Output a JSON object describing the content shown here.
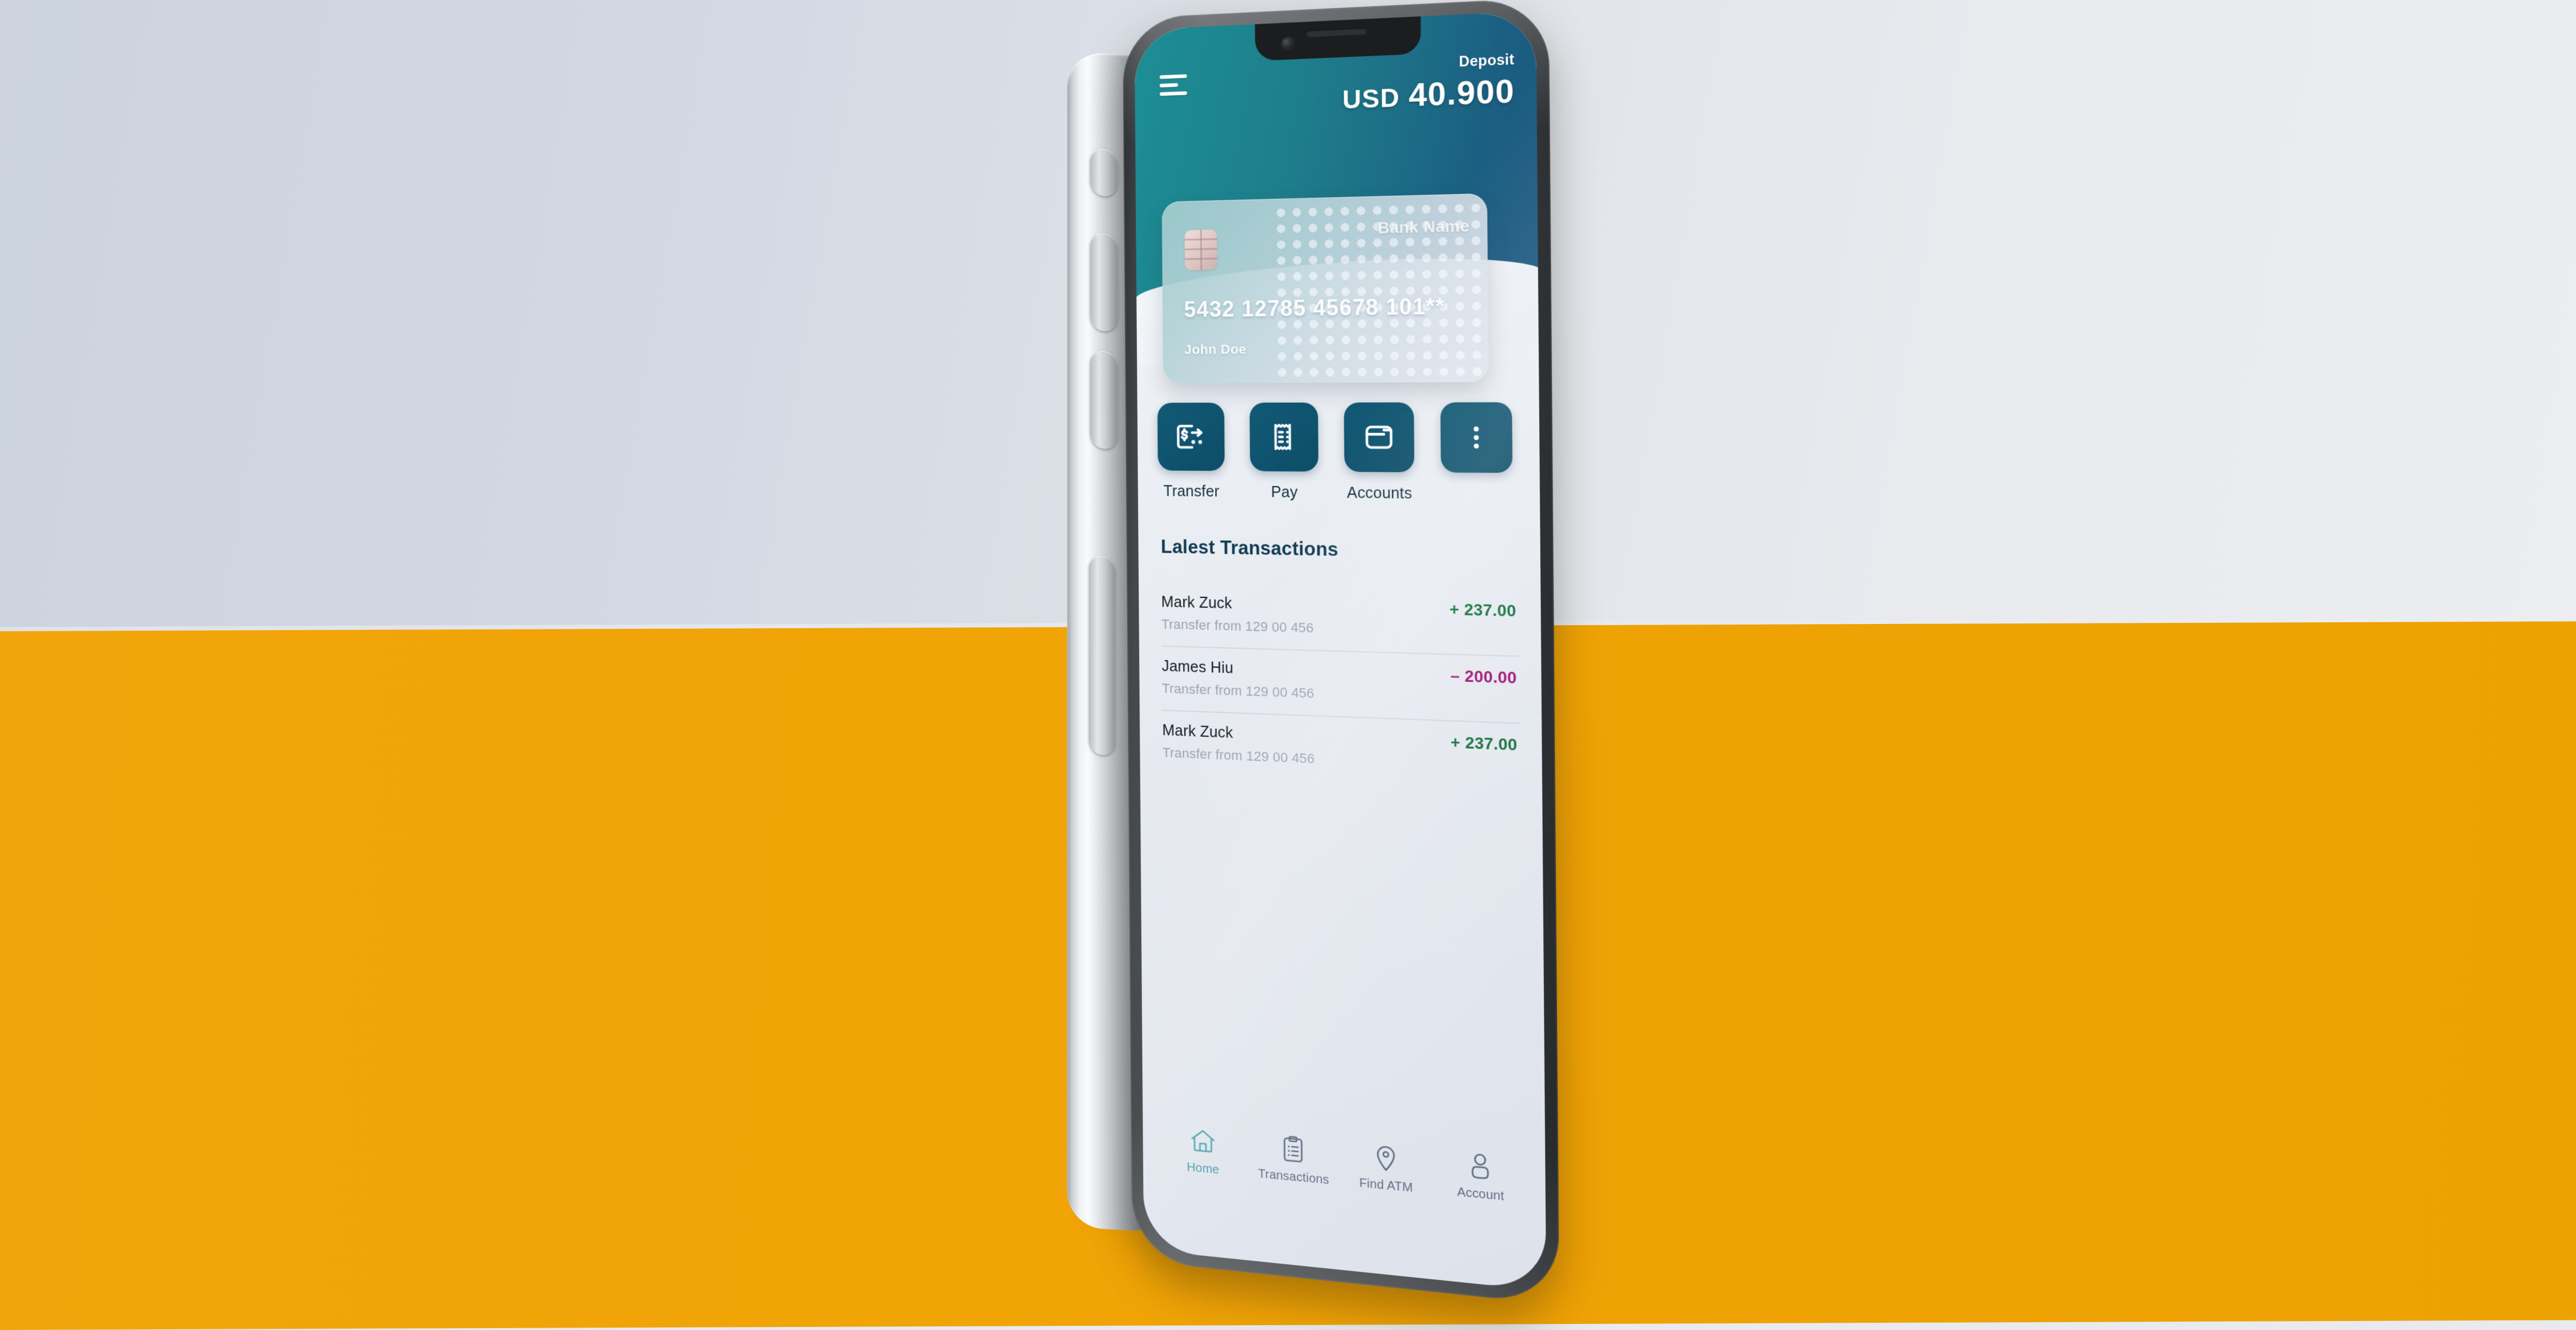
{
  "background": {
    "top_color": "#d6dbe4",
    "bottom_color": "#f0a406"
  },
  "device": {
    "frame_color": "#43464a",
    "side_rail_color": "#d9dde0"
  },
  "app": {
    "accent_teal": "#1d8e96",
    "accent_deep": "#0f5470",
    "header": {
      "menu_icon": "hamburger-menu-icon",
      "balance_label": "Deposit",
      "currency": "USD",
      "balance_amount": "40.900"
    },
    "card": {
      "chip_icon": "card-chip-icon",
      "bank_name": "Bank Name",
      "number": "5432 12785 45678 101**",
      "holder": "John Doe"
    },
    "actions": [
      {
        "label": "Transfer",
        "icon": "money-transfer-icon"
      },
      {
        "label": "Pay",
        "icon": "receipt-bill-icon"
      },
      {
        "label": "Accounts",
        "icon": "wallet-card-icon"
      },
      {
        "label": "",
        "icon": "more-icon"
      }
    ],
    "transactions": {
      "title": "Lalest Transactions",
      "rows": [
        {
          "name": "Mark Zuck",
          "detail": "Transfer from 129 00 456",
          "amount": "+ 237.00",
          "sign": "pos"
        },
        {
          "name": "James Hiu",
          "detail": "Transfer from 129 00 456",
          "amount": "– 200.00",
          "sign": "neg"
        },
        {
          "name": "Mark Zuck",
          "detail": "Transfer from 129 00 456",
          "amount": "+ 237.00",
          "sign": "pos"
        }
      ]
    },
    "bottom_nav": [
      {
        "label": "Home",
        "icon": "home-icon",
        "active": true
      },
      {
        "label": "Transactions",
        "icon": "clipboard-list-icon",
        "active": false
      },
      {
        "label": "Find ATM",
        "icon": "map-pin-icon",
        "active": false
      },
      {
        "label": "Account",
        "icon": "user-icon",
        "active": false
      }
    ]
  }
}
